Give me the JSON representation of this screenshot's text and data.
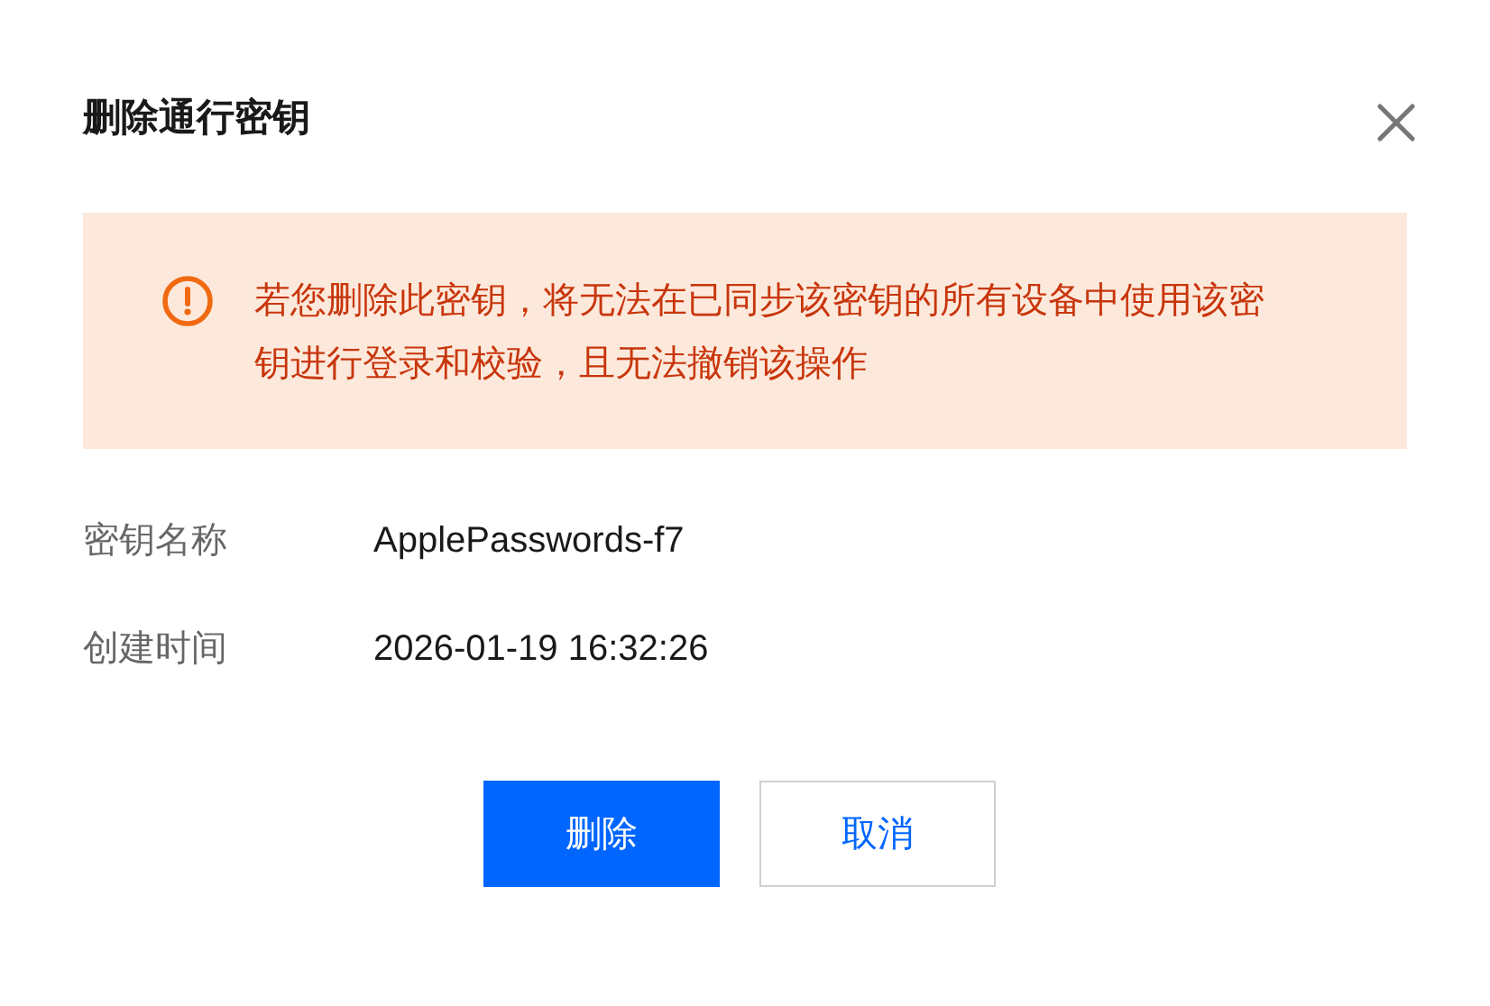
{
  "dialog": {
    "title": "删除通行密钥"
  },
  "alert": {
    "message": "若您删除此密钥，将无法在已同步该密钥的所有设备中使用该密钥进行登录和校验，且无法撤销该操作"
  },
  "fields": [
    {
      "label": "密钥名称",
      "value": "ApplePasswords-f7"
    },
    {
      "label": "创建时间",
      "value": "2026-01-19 16:32:26"
    }
  ],
  "buttons": [
    {
      "label": "删除",
      "kind": "primary"
    },
    {
      "label": "取消",
      "kind": "secondary"
    }
  ]
}
